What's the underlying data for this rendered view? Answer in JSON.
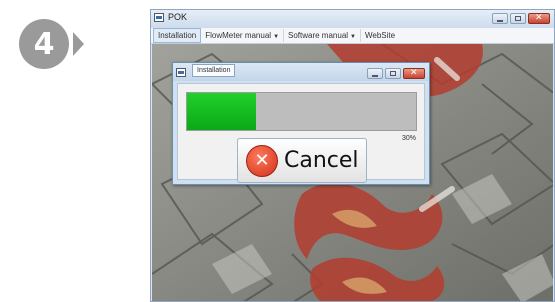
{
  "step": {
    "number": "4"
  },
  "main_window": {
    "title": "POK",
    "menu": [
      {
        "label": "Installation",
        "has_caret": false
      },
      {
        "label": "FlowMeter manual",
        "has_caret": true
      },
      {
        "label": "Software manual",
        "has_caret": true
      },
      {
        "label": "WebSite",
        "has_caret": false
      }
    ]
  },
  "dialog": {
    "title": "Installation",
    "progress_percent": 30,
    "progress_text": "30%",
    "cancel_label": "Cancel"
  },
  "icons": {
    "cancel": "x-circle-icon",
    "app": "window-app-icon"
  },
  "colors": {
    "progress_fill": "#12c020",
    "step_badge": "#9a9a9a"
  }
}
